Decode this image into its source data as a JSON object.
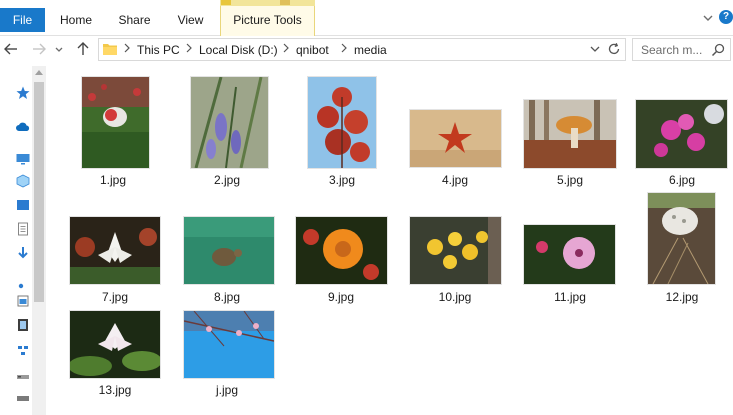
{
  "ribbon": {
    "tabs": [
      {
        "label": "File"
      },
      {
        "label": "Home"
      },
      {
        "label": "Share"
      },
      {
        "label": "View"
      },
      {
        "label": "Picture Tools"
      }
    ]
  },
  "address": {
    "breadcrumbs": [
      "This PC",
      "Local Disk (D:)",
      "qnibot",
      "media"
    ]
  },
  "search": {
    "placeholder": "Search m..."
  },
  "files": [
    {
      "name": "1.jpg"
    },
    {
      "name": "2.jpg"
    },
    {
      "name": "3.jpg"
    },
    {
      "name": "4.jpg"
    },
    {
      "name": "5.jpg"
    },
    {
      "name": "6.jpg"
    },
    {
      "name": "7.jpg"
    },
    {
      "name": "8.jpg"
    },
    {
      "name": "9.jpg"
    },
    {
      "name": "10.jpg"
    },
    {
      "name": "11.jpg"
    },
    {
      "name": "12.jpg"
    },
    {
      "name": "13.jpg"
    },
    {
      "name": "j.jpg"
    }
  ],
  "colors": {
    "accent": "#1979ca",
    "contextual_tab": "#f2e59a"
  }
}
